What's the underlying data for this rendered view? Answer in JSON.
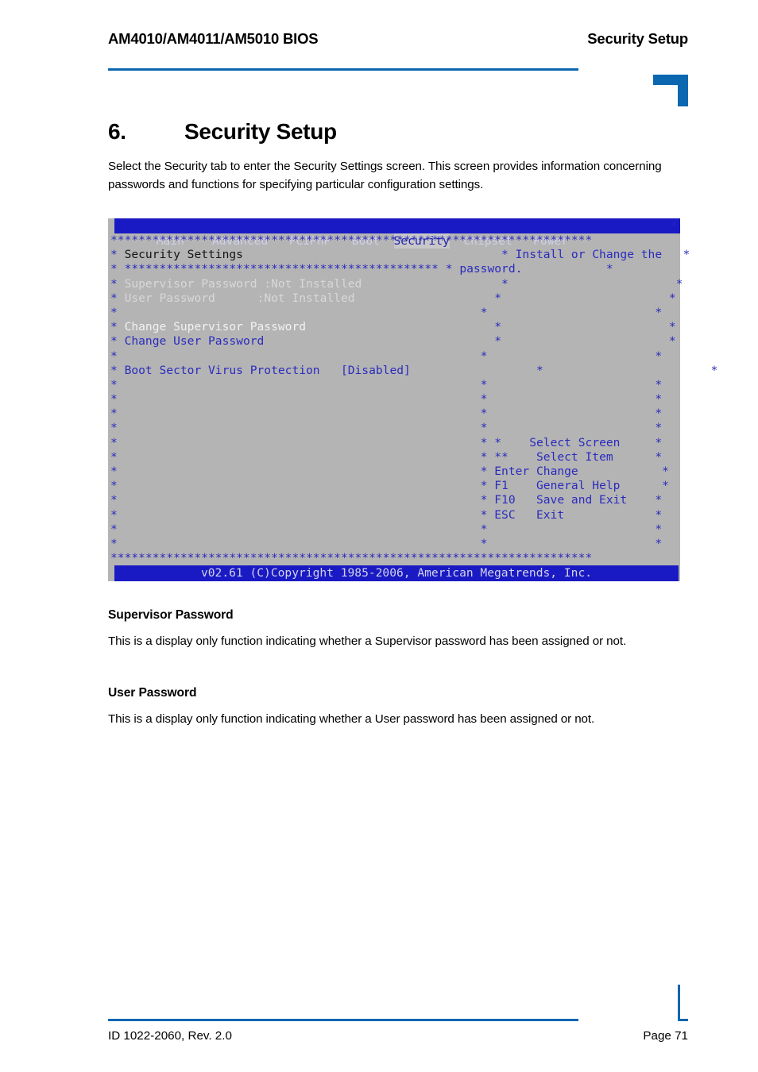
{
  "header": {
    "left": "AM4010/AM4011/AM5010 BIOS",
    "right": "Security Setup"
  },
  "section": {
    "number": "6.",
    "title": "Security Setup",
    "intro": "Select the Security tab to enter the Security Settings screen. This screen provides information concerning passwords and functions for specifying particular configuration settings."
  },
  "bios": {
    "tabs": [
      {
        "label": "Main",
        "selected": false
      },
      {
        "label": "Advanced",
        "selected": false
      },
      {
        "label": "PCIPnP",
        "selected": false
      },
      {
        "label": "Boot",
        "selected": false
      },
      {
        "label": "Security",
        "selected": true
      },
      {
        "label": "Chipset",
        "selected": false
      },
      {
        "label": "Power",
        "selected": false
      }
    ],
    "edge_star": "*",
    "rule_full": "*********************************************************************",
    "panel_title": "Security Settings",
    "panel_rule": "*********************************************",
    "left_items": [
      {
        "label": "Supervisor Password",
        "value": ":Not Installed",
        "style": "dim"
      },
      {
        "label": "User Password",
        "value": ":Not Installed",
        "style": "dim"
      },
      {
        "label": "Change Supervisor Password",
        "value": "",
        "style": "white"
      },
      {
        "label": "Change User Password",
        "value": "",
        "style": "blue"
      },
      {
        "label": "Boot Sector Virus Protection",
        "value": "[Disabled]",
        "style": "blue"
      }
    ],
    "help_lines": [
      "Install or Change the",
      "password."
    ],
    "keys": [
      {
        "key": "*",
        "desc": "Select Screen"
      },
      {
        "key": "**",
        "desc": "Select Item"
      },
      {
        "key": "Enter",
        "desc": "Change"
      },
      {
        "key": "F1",
        "desc": "General Help"
      },
      {
        "key": "F10",
        "desc": "Save and Exit"
      },
      {
        "key": "ESC",
        "desc": "Exit"
      }
    ],
    "footer": "v02.61 (C)Copyright 1985-2006, American Megatrends, Inc."
  },
  "subsections": [
    {
      "heading": "Supervisor Password",
      "body": "This is a display only function indicating whether a Supervisor password has been assigned or not."
    },
    {
      "heading": "User Password",
      "body": "This is a display only function indicating whether a User password has been assigned or not."
    }
  ],
  "footer": {
    "left": "ID 1022-2060, Rev. 2.0",
    "right": "Page 71"
  },
  "colors": {
    "accent_blue": "#0a67b0",
    "bios_blue": "#1a1ac4",
    "bios_text_blue": "#2b2bbe",
    "bios_bg": "#b4b4b4",
    "bios_tab_selected_bg": "#c8c8c8"
  }
}
